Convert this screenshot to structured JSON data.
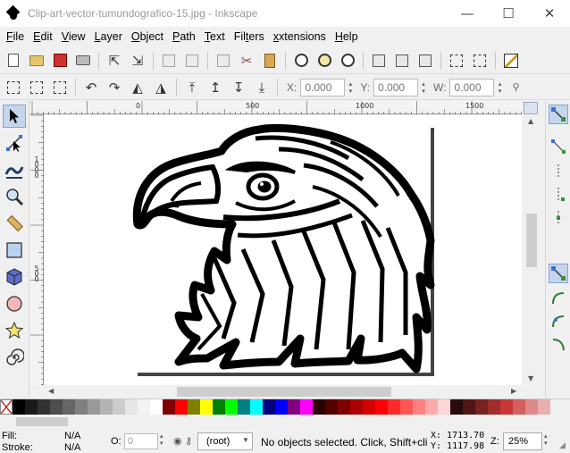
{
  "window": {
    "title": "Clip-art-vector-tumundografico-15.jpg - Inkscape",
    "minimize": "—",
    "maximize": "☐",
    "close": "✕"
  },
  "menu": [
    "File",
    "Edit",
    "View",
    "Layer",
    "Object",
    "Path",
    "Text",
    "Filters",
    "Extensions",
    "Help"
  ],
  "menu_underline": [
    "F",
    "E",
    "V",
    "L",
    "O",
    "P",
    "T",
    "r",
    "x",
    "H"
  ],
  "toolbar_fields": {
    "x_label": "X:",
    "x_value": "0.000",
    "y_label": "Y:",
    "y_value": "0.000",
    "w_label": "W:",
    "w_value": "0.000"
  },
  "ruler_top": [
    "0",
    "500",
    "1000",
    "1500"
  ],
  "ruler_left": [
    "1000",
    "500"
  ],
  "palette_colors": [
    "#000000",
    "#1a1a1a",
    "#333333",
    "#4d4d4d",
    "#666666",
    "#808080",
    "#999999",
    "#b3b3b3",
    "#cccccc",
    "#e6e6e6",
    "#f2f2f2",
    "#ffffff",
    "#800000",
    "#ff0000",
    "#808000",
    "#ffff00",
    "#008000",
    "#00ff00",
    "#008080",
    "#00ffff",
    "#000080",
    "#0000ff",
    "#800080",
    "#ff00ff",
    "#2b0000",
    "#550000",
    "#800000",
    "#aa0000",
    "#d40000",
    "#ff0000",
    "#ff2a2a",
    "#ff5555",
    "#ff8080",
    "#ffaaaa",
    "#ffd5d5",
    "#280b0b",
    "#501616",
    "#782121",
    "#a02c2c",
    "#c83737",
    "#d35f5f",
    "#de8787",
    "#e9afaf"
  ],
  "status": {
    "fill_label": "Fill:",
    "fill_value": "N/A",
    "stroke_label": "Stroke:",
    "stroke_value": "N/A",
    "opacity_label": "O:",
    "opacity_value": "0",
    "layer": "(root)",
    "message": "No objects selected. Click, Shift+cli",
    "x_coord": "X: 1713.70",
    "y_coord": "Y: 1117.98",
    "zoom_label": "Z:",
    "zoom_value": "25%"
  }
}
